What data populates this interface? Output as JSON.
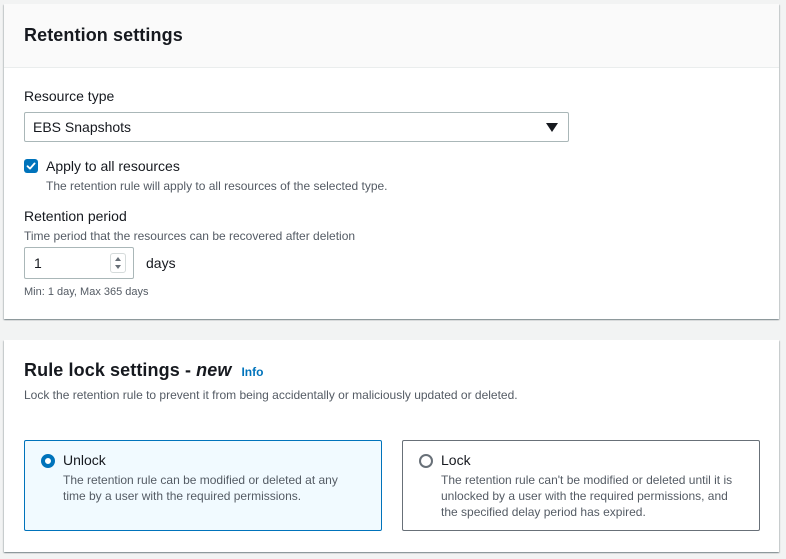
{
  "retention": {
    "title": "Retention settings",
    "resource_type": {
      "label": "Resource type",
      "value": "EBS Snapshots"
    },
    "apply_all": {
      "label": "Apply to all resources",
      "description": "The retention rule will apply to all resources of the selected type.",
      "checked": true
    },
    "period": {
      "label": "Retention period",
      "description": "Time period that the resources can be recovered after deletion",
      "value": "1",
      "unit": "days",
      "constraint": "Min: 1 day, Max 365 days"
    }
  },
  "lock": {
    "title": "Rule lock settings - ",
    "title_new": "new",
    "info": "Info",
    "description": "Lock the retention rule to prevent it from being accidentally or maliciously updated or deleted.",
    "options": [
      {
        "label": "Unlock",
        "description": "The retention rule can be modified or deleted at any time by a user with the required permissions.",
        "selected": true
      },
      {
        "label": "Lock",
        "description": "The retention rule can't be modified or deleted until it is unlocked by a user with the required permissions, and the specified delay period has expired.",
        "selected": false
      }
    ]
  },
  "colors": {
    "accent": "#0073bb",
    "selected_tile_bg": "#f1faff",
    "page_bg": "#f2f3f3"
  }
}
